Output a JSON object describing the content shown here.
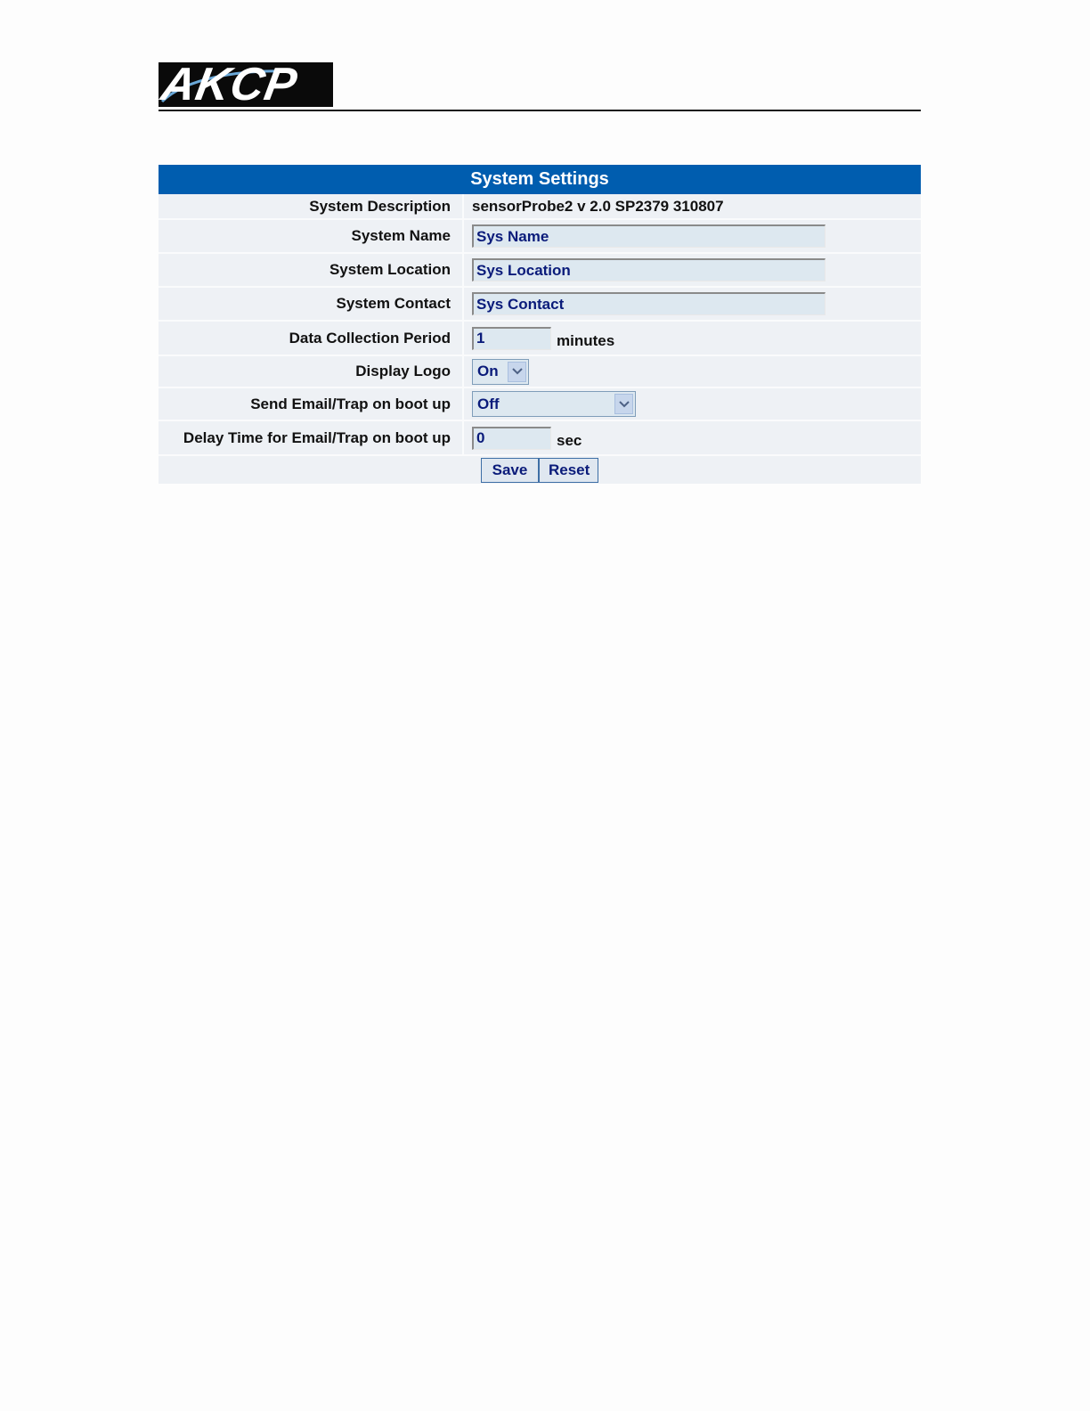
{
  "header": {
    "logo_text": "AKCP"
  },
  "panel": {
    "title": "System Settings",
    "rows": {
      "description": {
        "label": "System Description",
        "value": "sensorProbe2 v 2.0 SP2379 310807"
      },
      "name": {
        "label": "System Name",
        "value": "Sys Name"
      },
      "location": {
        "label": "System Location",
        "value": "Sys Location"
      },
      "contact": {
        "label": "System Contact",
        "value": "Sys Contact"
      },
      "collection_period": {
        "label": "Data Collection Period",
        "value": "1",
        "unit": "minutes"
      },
      "display_logo": {
        "label": "Display Logo",
        "selected": "On"
      },
      "send_on_boot": {
        "label": "Send Email/Trap on boot up",
        "selected": "Off"
      },
      "delay_time": {
        "label": "Delay Time for Email/Trap on boot up",
        "value": "0",
        "unit": "sec"
      }
    },
    "buttons": {
      "save_label": "Save",
      "reset_label": "Reset"
    }
  },
  "colors": {
    "title_bar": "#005daf",
    "row_bg": "#eef1f5",
    "input_bg": "#dde8f0",
    "input_text": "#0a1b7a"
  }
}
